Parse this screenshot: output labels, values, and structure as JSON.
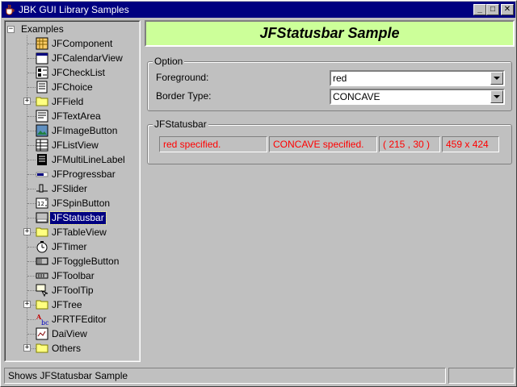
{
  "window": {
    "title": "JBK GUI Library Samples",
    "minimize": "_",
    "maximize": "□",
    "close": "✕"
  },
  "tree": {
    "root": "Examples",
    "items": [
      {
        "label": "JFComponent",
        "icon": "grid-component-icon",
        "expandable": false
      },
      {
        "label": "JFCalendarView",
        "icon": "calendar-icon",
        "expandable": false
      },
      {
        "label": "JFCheckList",
        "icon": "checklist-icon",
        "expandable": false
      },
      {
        "label": "JFChoice",
        "icon": "choice-icon",
        "expandable": false
      },
      {
        "label": "JFField",
        "icon": "folder-icon",
        "expandable": true
      },
      {
        "label": "JFTextArea",
        "icon": "textarea-icon",
        "expandable": false
      },
      {
        "label": "JFImageButton",
        "icon": "image-button-icon",
        "expandable": false
      },
      {
        "label": "JFListView",
        "icon": "listview-icon",
        "expandable": false
      },
      {
        "label": "JFMultiLineLabel",
        "icon": "multiline-label-icon",
        "expandable": false
      },
      {
        "label": "JFProgressbar",
        "icon": "progressbar-icon",
        "expandable": false
      },
      {
        "label": "JFSlider",
        "icon": "slider-icon",
        "expandable": false
      },
      {
        "label": "JFSpinButton",
        "icon": "spinbutton-icon",
        "expandable": false
      },
      {
        "label": "JFStatusbar",
        "icon": "statusbar-icon",
        "expandable": false,
        "selected": true
      },
      {
        "label": "JFTableView",
        "icon": "folder-icon",
        "expandable": true
      },
      {
        "label": "JFTimer",
        "icon": "timer-icon",
        "expandable": false
      },
      {
        "label": "JFToggleButton",
        "icon": "toggle-button-icon",
        "expandable": false
      },
      {
        "label": "JFToolbar",
        "icon": "toolbar-icon",
        "expandable": false
      },
      {
        "label": "JFToolTip",
        "icon": "tooltip-icon",
        "expandable": false
      },
      {
        "label": "JFTree",
        "icon": "folder-icon",
        "expandable": true
      },
      {
        "label": "JFRTFEditor",
        "icon": "rtf-editor-icon",
        "expandable": false
      },
      {
        "label": "DaiView",
        "icon": "daiview-icon",
        "expandable": false
      },
      {
        "label": "Others",
        "icon": "folder-icon",
        "expandable": true
      }
    ]
  },
  "header": {
    "title": "JFStatusbar Sample",
    "background": "#ccff99"
  },
  "option": {
    "group_title": "Option",
    "foreground_label": "Foreground:",
    "foreground_value": "red",
    "border_label": "Border Type:",
    "border_value": "CONCAVE"
  },
  "statusbar_demo": {
    "group_title": "JFStatusbar",
    "text_color": "#ff0000",
    "cells": [
      "red specified.",
      "CONCAVE specified.",
      "( 215 , 30 )",
      "459 x 424"
    ]
  },
  "statusbar": {
    "message": "Shows JFStatusbar Sample",
    "extra": ""
  },
  "colors": {
    "titlebar": "#000080",
    "selection": "#000080",
    "face": "#c0c0c0"
  }
}
